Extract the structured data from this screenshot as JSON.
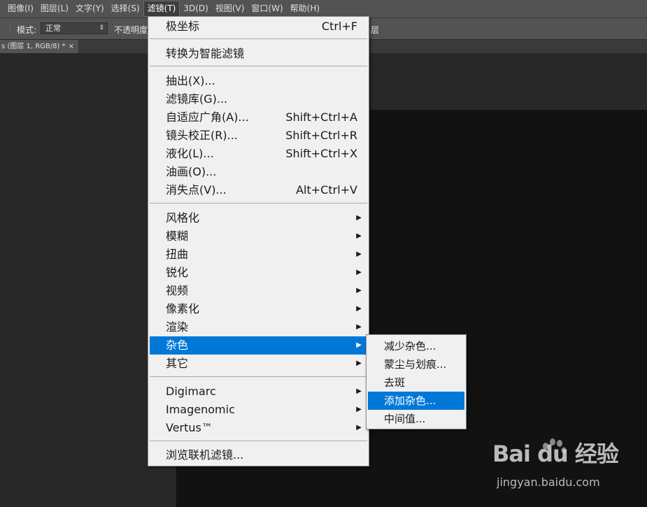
{
  "menubar": {
    "items": [
      "图像(I)",
      "图层(L)",
      "文字(Y)",
      "选择(S)",
      "滤镜(T)",
      "3D(D)",
      "视图(V)",
      "窗口(W)",
      "帮助(H)"
    ],
    "active_index": 4
  },
  "options": {
    "mode_label": "模式:",
    "mode_value": "正常",
    "opacity_label": "不透明度:",
    "layer_fragment": "层"
  },
  "document_tab": {
    "title": "s (图层 1, RGB/8) *",
    "close": "×"
  },
  "filter_menu": {
    "items": [
      {
        "label": "极坐标",
        "shortcut": "Ctrl+F"
      },
      {
        "label": "转换为智能滤镜"
      },
      {
        "label": "抽出(X)..."
      },
      {
        "label": "滤镜库(G)..."
      },
      {
        "label": "自适应广角(A)...",
        "shortcut": "Shift+Ctrl+A"
      },
      {
        "label": "镜头校正(R)...",
        "shortcut": "Shift+Ctrl+R"
      },
      {
        "label": "液化(L)...",
        "shortcut": "Shift+Ctrl+X"
      },
      {
        "label": "油画(O)..."
      },
      {
        "label": "消失点(V)...",
        "shortcut": "Alt+Ctrl+V"
      },
      {
        "label": "风格化",
        "submenu": true
      },
      {
        "label": "模糊",
        "submenu": true
      },
      {
        "label": "扭曲",
        "submenu": true
      },
      {
        "label": "锐化",
        "submenu": true
      },
      {
        "label": "视频",
        "submenu": true
      },
      {
        "label": "像素化",
        "submenu": true
      },
      {
        "label": "渲染",
        "submenu": true
      },
      {
        "label": "杂色",
        "submenu": true,
        "highlighted": true
      },
      {
        "label": "其它",
        "submenu": true
      },
      {
        "label": "Digimarc",
        "submenu": true
      },
      {
        "label": "Imagenomic",
        "submenu": true
      },
      {
        "label": "Vertus™",
        "submenu": true
      },
      {
        "label": "浏览联机滤镜..."
      }
    ]
  },
  "noise_submenu": {
    "items": [
      {
        "label": "减少杂色..."
      },
      {
        "label": "蒙尘与划痕..."
      },
      {
        "label": "去斑"
      },
      {
        "label": "添加杂色...",
        "highlighted": true
      },
      {
        "label": "中间值..."
      }
    ]
  },
  "watermark": {
    "brand": "Bai du 经验",
    "url": "jingyan.baidu.com"
  },
  "colors": {
    "highlight": "#0078d7",
    "menu_bg": "#f0f0f0",
    "chrome": "#535353",
    "canvas": "#121212"
  }
}
